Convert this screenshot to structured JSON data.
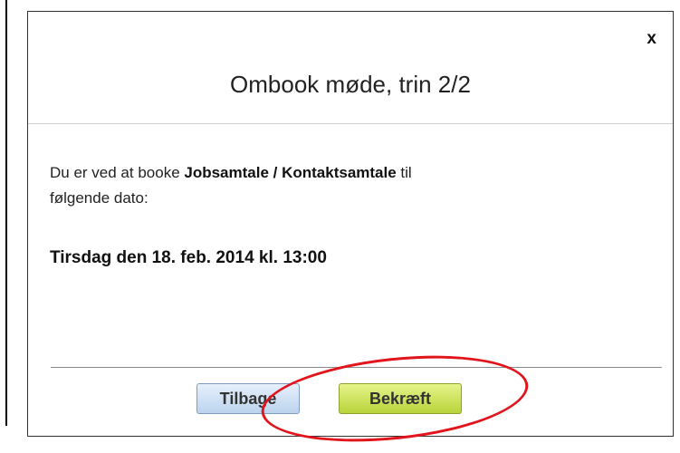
{
  "dialog": {
    "close_label": "x",
    "title": "Ombook møde, trin 2/2",
    "message": {
      "prefix": "Du er ved at booke ",
      "meeting_type": "Jobsamtale / Kontaktsamtale",
      "suffix_line1": " til",
      "line2": "følgende dato:"
    },
    "date_text": "Tirsdag den 18. feb. 2014 kl. 13:00",
    "buttons": {
      "back_label": "Tilbage",
      "confirm_label": "Bekræft"
    }
  },
  "colors": {
    "highlight_ring": "#e2141c",
    "confirm_button": "#c8df4a",
    "back_button": "#cfe0f3"
  }
}
